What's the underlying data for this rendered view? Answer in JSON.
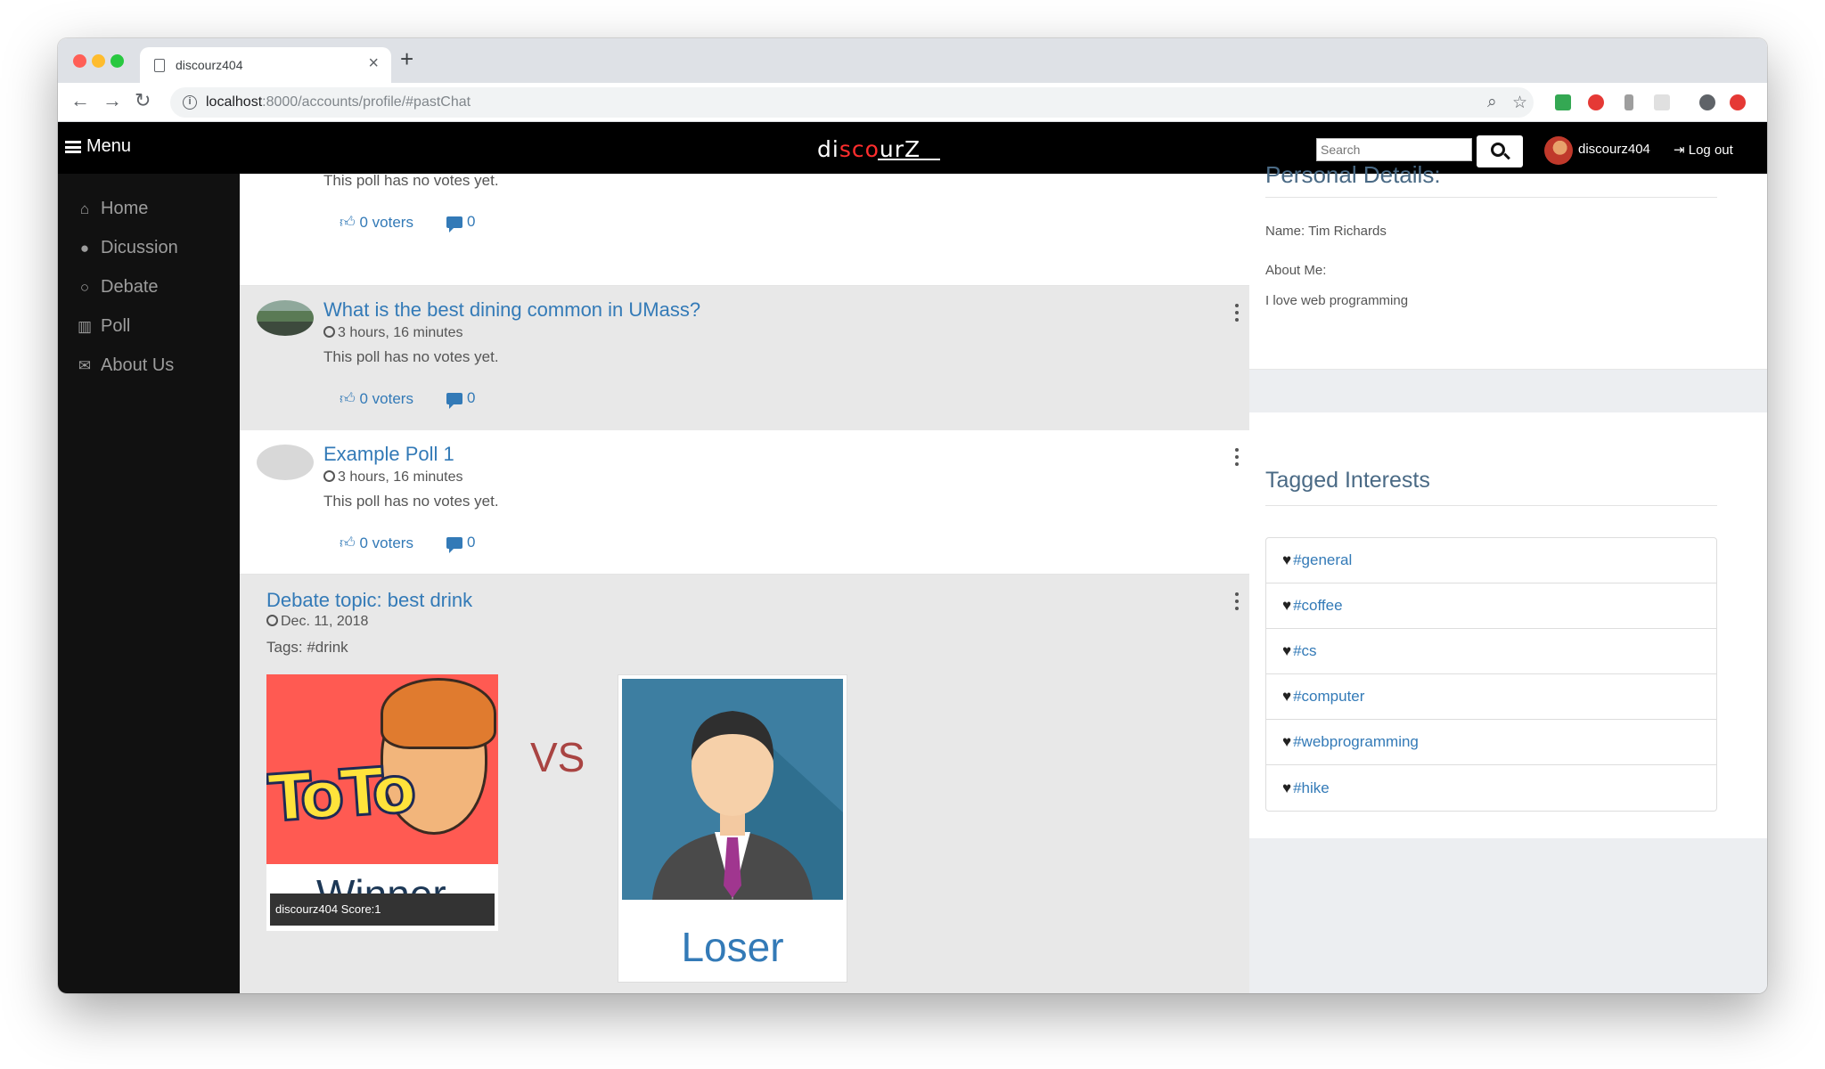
{
  "browser": {
    "tab_title": "discourz404",
    "new_tab": "+",
    "url_host": "localhost",
    "url_rest": ":8000/accounts/profile/#pastChat"
  },
  "navbar": {
    "menu_label": "Menu",
    "logo_part1": "di",
    "logo_part2": "s",
    "logo_part3": "co",
    "logo_part4": "urZ",
    "search_placeholder": "Search",
    "username": "discourz404",
    "logout_label": "Log out"
  },
  "sidebar": {
    "items": [
      {
        "label": "Home",
        "icon": "home-icon"
      },
      {
        "label": "Dicussion",
        "icon": "users-icon"
      },
      {
        "label": "Debate",
        "icon": "chat-icon"
      },
      {
        "label": "Poll",
        "icon": "bar-chart-icon"
      },
      {
        "label": "About Us",
        "icon": "envelope-icon"
      }
    ]
  },
  "feed": {
    "top_partial": {
      "desc": "This poll has no votes yet.",
      "voters": "0 voters",
      "comments": "0"
    },
    "polls": [
      {
        "title": "What is the best dining common in UMass?",
        "time": "3 hours, 16 minutes",
        "desc": "This poll has no votes yet.",
        "voters": "0 voters",
        "comments": "0"
      },
      {
        "title": "Example Poll 1",
        "time": "3 hours, 16 minutes",
        "desc": "This poll has no votes yet.",
        "voters": "0 voters",
        "comments": "0"
      }
    ],
    "debate": {
      "title": "Debate topic: best drink",
      "date": "Dec. 11, 2018",
      "tags": "Tags: #drink",
      "card_a_logo": "ToTo",
      "card_a_label": "Winner",
      "card_a_score": "discourz404 Score:1",
      "vs": "VS",
      "card_b_label": "Loser"
    }
  },
  "profile": {
    "personal_title": "Personal Details:",
    "name_line": "Name: Tim Richards",
    "about_label": "About Me:",
    "about_text": "I love web programming",
    "interests_title": "Tagged Interests",
    "tags": [
      "#general",
      "#coffee",
      "#cs",
      "#computer",
      "#webprogramming",
      "#hike"
    ]
  },
  "colors": {
    "link": "#337ab7",
    "navbar": "#000000",
    "sidebar": "#111111",
    "vs": "#a94442"
  }
}
